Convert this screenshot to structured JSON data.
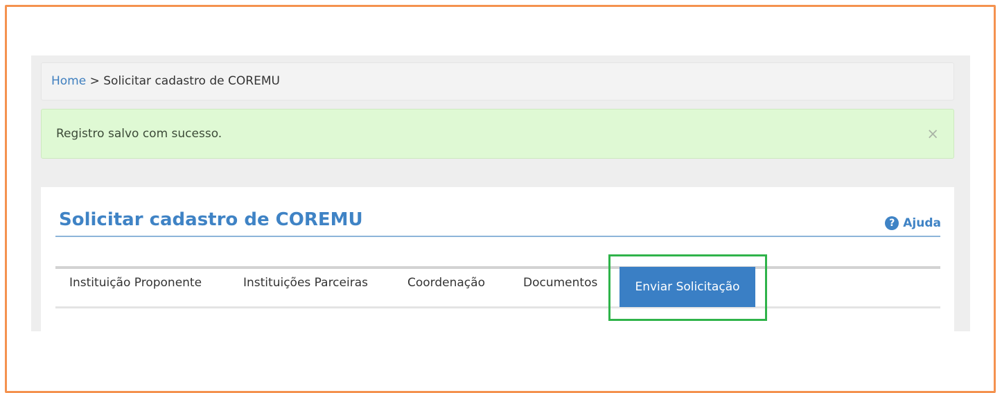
{
  "breadcrumb": {
    "home": "Home",
    "separator": ">",
    "current": "Solicitar cadastro de COREMU"
  },
  "alert": {
    "message": "Registro salvo com sucesso.",
    "close": "×"
  },
  "page": {
    "title": "Solicitar cadastro de COREMU",
    "help_label": "Ajuda",
    "help_icon": "?"
  },
  "tabs": [
    {
      "label": "Instituição Proponente"
    },
    {
      "label": "Instituições Parceiras"
    },
    {
      "label": "Coordenação"
    },
    {
      "label": "Documentos"
    },
    {
      "label": "Enviar Solicitação",
      "active": true
    }
  ],
  "colors": {
    "accent": "#3f83c5",
    "alert_bg": "#dff9d4",
    "frame": "#f4924f",
    "highlight": "#2fb34a"
  }
}
